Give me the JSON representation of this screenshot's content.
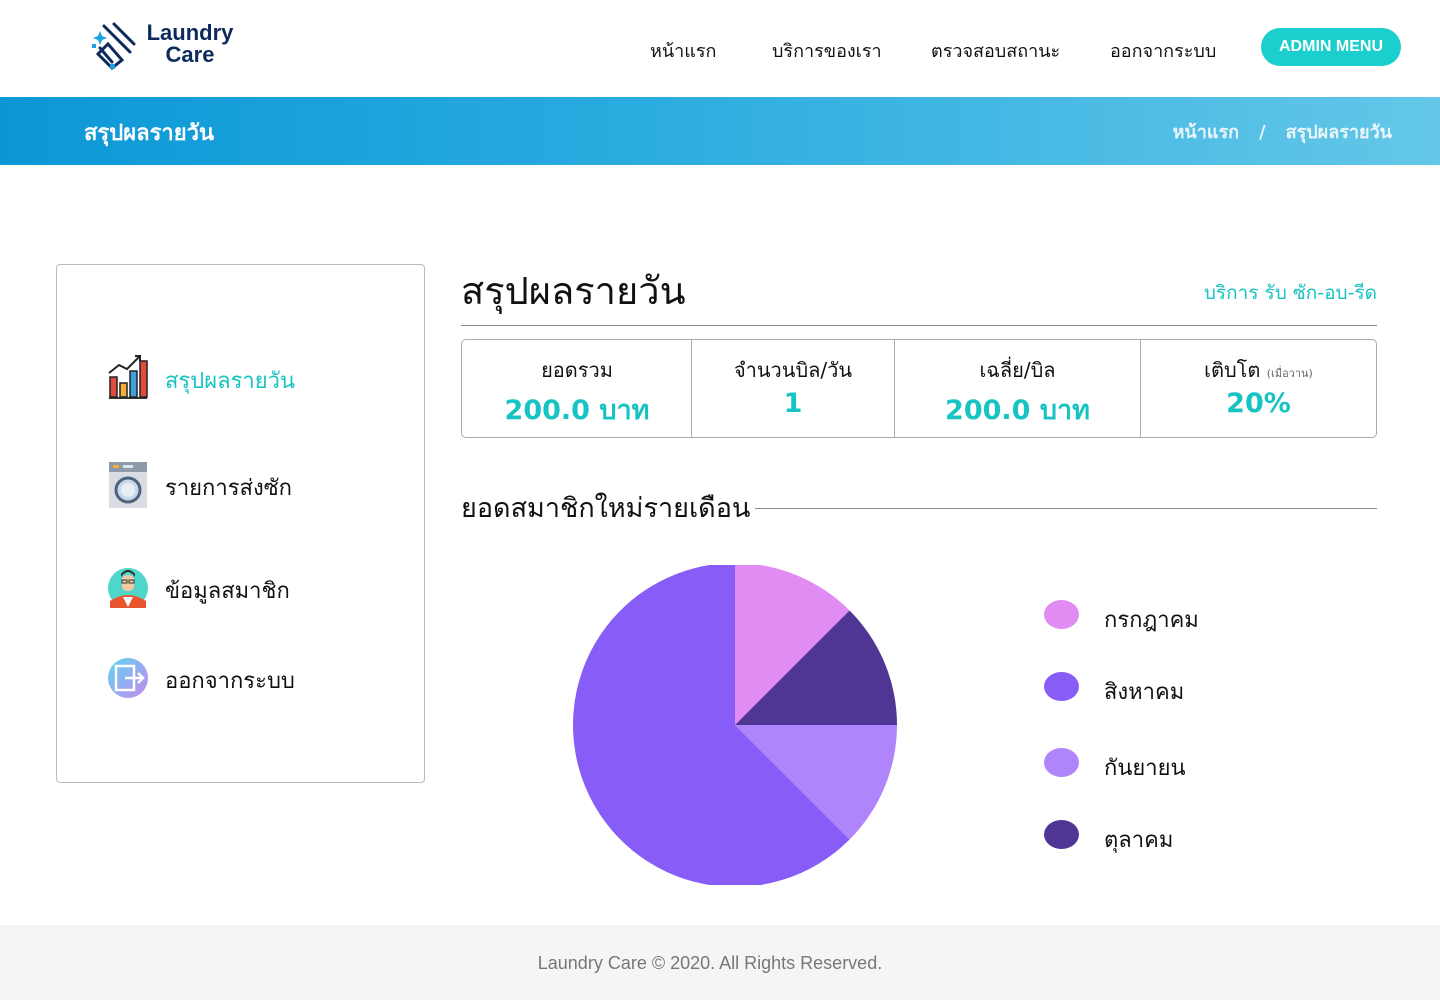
{
  "header": {
    "logo_line1": "Laundry",
    "logo_line2": "Care",
    "nav": [
      "หน้าแรก",
      "บริการของเรา",
      "ตรวจสอบสถานะ",
      "ออกจากระบบ"
    ],
    "admin_button": "ADMIN MENU"
  },
  "banner": {
    "title": "สรุปผลรายวัน",
    "breadcrumb": [
      "หน้าแรก",
      "/",
      "สรุปผลรายวัน"
    ]
  },
  "sidebar": {
    "items": [
      {
        "label": "สรุปผลรายวัน",
        "icon": "bar-chart-icon",
        "active": true
      },
      {
        "label": "รายการส่งซัก",
        "icon": "washing-machine-icon",
        "active": false
      },
      {
        "label": "ข้อมูลสมาชิก",
        "icon": "member-avatar-icon",
        "active": false
      },
      {
        "label": "ออกจากระบบ",
        "icon": "logout-icon",
        "active": false
      }
    ]
  },
  "main": {
    "title": "สรุปผลรายวัน",
    "subtitle": "บริการ รับ ซัก-อบ-รีด",
    "stats": [
      {
        "label": "ยอดรวม",
        "value": "200.0 บาท"
      },
      {
        "label": "จำนวนบิล/วัน",
        "value": "1"
      },
      {
        "label": "เฉลี่ย/บิล",
        "value": "200.0 บาท"
      },
      {
        "label": "เติบโต",
        "label_note": "(เมื่อวาน)",
        "value": "20%"
      }
    ],
    "chart_section_title": "ยอดสมาชิกใหม่รายเดือน"
  },
  "chart_data": {
    "type": "pie",
    "categories": [
      "กรกฎาคม",
      "สิงหาคม",
      "กันยายน",
      "ตุลาคม"
    ],
    "values": [
      1,
      5,
      1,
      1
    ],
    "colors": [
      "#e18cf2",
      "#875cf7",
      "#b085fc",
      "#4f3694"
    ],
    "legend_position": "right"
  },
  "colors": {
    "accent": "#17c3c3",
    "admin_button": "#1ccfcf",
    "banner_start": "#0b97d6",
    "banner_end": "#64c7e8",
    "logo_text": "#0d2a5c"
  },
  "footer": {
    "text": "Laundry Care © 2020. All Rights Reserved."
  }
}
